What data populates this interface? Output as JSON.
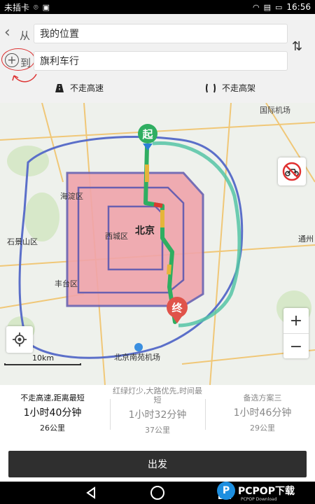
{
  "status_bar": {
    "carrier": "未插卡",
    "time": "16:56"
  },
  "route": {
    "from_label": "从",
    "from_value": "我的位置",
    "to_label": "到",
    "to_value": "旗利车行"
  },
  "options": {
    "avoid_highway": "不走高速",
    "avoid_elevated": "不走高架"
  },
  "map": {
    "labels": {
      "airport": "国际机场",
      "haidian": "海淀区",
      "xicheng": "西城区",
      "beijing": "北京",
      "shijingshan": "石景山区",
      "fengtai": "丰台区",
      "tongzhou": "通州",
      "nanyuan": "北京南苑机场",
      "start_marker": "起",
      "end_marker": "终"
    },
    "scale": "10km",
    "zoom_in": "+",
    "zoom_out": "−"
  },
  "plans": [
    {
      "title": "不走高速,距离最短",
      "time": "1小时40分钟",
      "distance": "26公里"
    },
    {
      "title": "红绿灯少,大路优先,时间最短",
      "time": "1小时32分钟",
      "distance": "37公里"
    },
    {
      "title": "备选方案三",
      "time": "1小时46分钟",
      "distance": "29公里"
    }
  ],
  "start_button": "出发",
  "watermark": {
    "brand": "PCPOP下载",
    "sub": "PCPOP Download"
  },
  "colors": {
    "accent_red": "#e0534a",
    "route_green": "#2fae61",
    "congestion_red": "#d93b2f"
  }
}
